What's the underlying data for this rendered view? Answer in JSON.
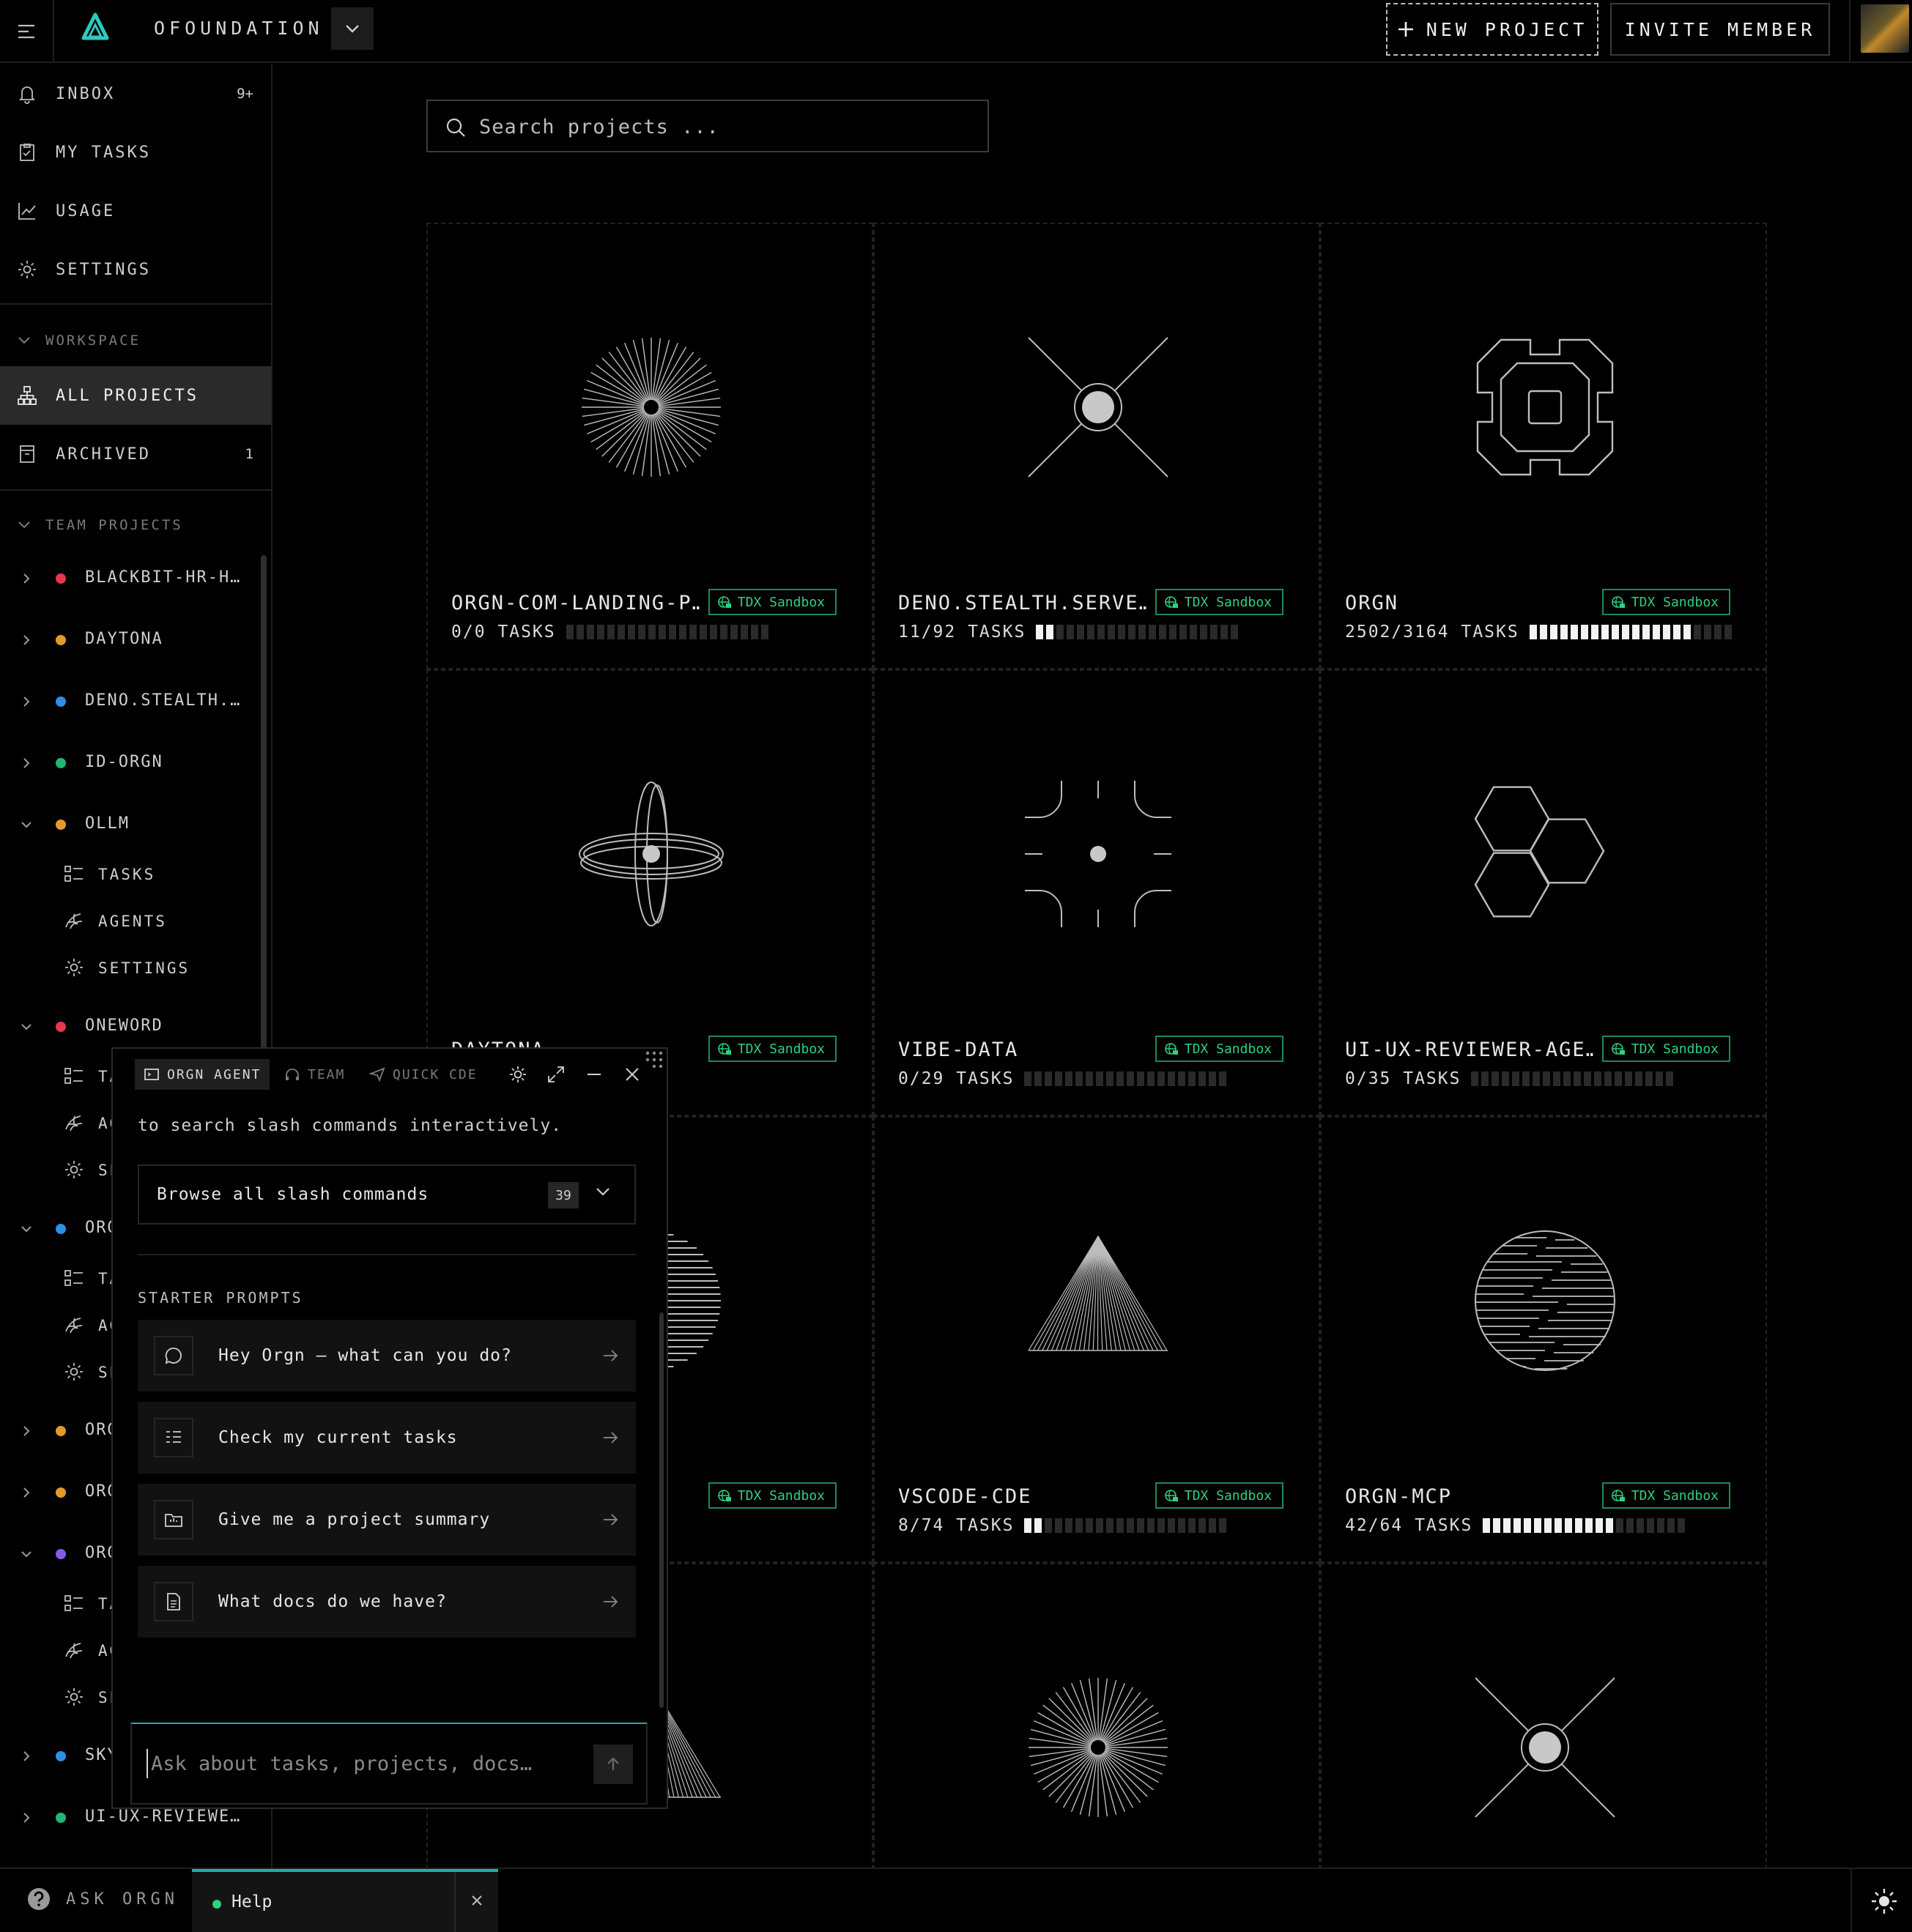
{
  "topbar": {
    "org_name": "OFOUNDATION",
    "new_project_label": "NEW PROJECT",
    "invite_label": "INVITE MEMBER"
  },
  "sidebar": {
    "nav": [
      {
        "label": "INBOX",
        "count": "9+",
        "icon": "bell-icon"
      },
      {
        "label": "MY TASKS",
        "icon": "clipboard-check-icon"
      },
      {
        "label": "USAGE",
        "icon": "chart-line-icon"
      },
      {
        "label": "SETTINGS",
        "icon": "gear-icon"
      }
    ],
    "workspace_label": "WORKSPACE",
    "workspace_items": [
      {
        "label": "ALL PROJECTS",
        "icon": "sitemap-icon"
      },
      {
        "label": "ARCHIVED",
        "count": "1",
        "icon": "archive-icon"
      }
    ],
    "team_projects_label": "TEAM PROJECTS",
    "projects": [
      {
        "label": "BLACKBIT-HR-H…",
        "color": "#e5384f"
      },
      {
        "label": "DAYTONA",
        "color": "#e09a2b"
      },
      {
        "label": "DENO.STEALTH.…",
        "color": "#2f8fe0"
      },
      {
        "label": "ID-ORGN",
        "color": "#22b573"
      },
      {
        "label": "OLLM",
        "color": "#e09a2b"
      },
      {
        "label": "ONEWORD",
        "color": "#e5384f"
      },
      {
        "label": "ORGN",
        "color": "#2f8fe0"
      },
      {
        "label": "ORGN-COM-LANDING-P…",
        "color": "#e09a2b"
      },
      {
        "label": "ORGN-MCP",
        "color": "#e09a2b"
      },
      {
        "label": "ORGN-WEB",
        "color": "#8a5ae0"
      },
      {
        "label": "SKY",
        "color": "#2f8fe0"
      },
      {
        "label": "UI-UX-REVIEWE…",
        "color": "#22b573"
      }
    ],
    "sub_items": {
      "tasks": "TASKS",
      "agents": "AGENTS",
      "settings": "SETTINGS"
    }
  },
  "search": {
    "placeholder": "Search projects ..."
  },
  "cards": [
    {
      "title": "ORGN-COM-LANDING-P…",
      "badge": "TDX Sandbox",
      "tasks": "0/0 TASKS",
      "progress": 0.0
    },
    {
      "title": "DENO.STEALTH.SERVE…",
      "badge": "TDX Sandbox",
      "tasks": "11/92 TASKS",
      "progress": 0.12
    },
    {
      "title": "ORGN",
      "badge": "TDX Sandbox",
      "tasks": "2502/3164 TASKS",
      "progress": 0.79
    },
    {
      "title": "DAYTONA",
      "badge": "TDX Sandbox",
      "tasks": "",
      "progress": 0.0
    },
    {
      "title": "VIBE-DATA",
      "badge": "TDX Sandbox",
      "tasks": "0/29 TASKS",
      "progress": 0.0
    },
    {
      "title": "UI-UX-REVIEWER-AGE…",
      "badge": "TDX Sandbox",
      "tasks": "0/35 TASKS",
      "progress": 0.0
    },
    {
      "title": "",
      "badge": "TDX Sandbox",
      "tasks": "",
      "progress": 0.0
    },
    {
      "title": "VSCODE-CDE",
      "badge": "TDX Sandbox",
      "tasks": "8/74 TASKS",
      "progress": 0.11
    },
    {
      "title": "ORGN-MCP",
      "badge": "TDX Sandbox",
      "tasks": "42/64 TASKS",
      "progress": 0.66
    }
  ],
  "agent": {
    "tabs": [
      "ORGN AGENT",
      "TEAM",
      "QUICK CDE"
    ],
    "hint": "to search slash commands interactively.",
    "browse_label": "Browse all slash commands",
    "browse_count": "39",
    "starter_label": "STARTER PROMPTS",
    "prompts": [
      {
        "text": "Hey Orgn — what can you do?",
        "icon": "chat-bubble-icon"
      },
      {
        "text": "Check my current tasks",
        "icon": "task-list-icon"
      },
      {
        "text": "Give me a project summary",
        "icon": "folder-icon"
      },
      {
        "text": "What docs do we have?",
        "icon": "document-icon"
      }
    ],
    "input_placeholder": "Ask about tasks, projects, docs…"
  },
  "bottombar": {
    "ask_label": "ASK ORGN",
    "help_label": "Help"
  },
  "colors": {
    "accent": "#1fb0a6",
    "badge_green": "#2fd07f"
  }
}
